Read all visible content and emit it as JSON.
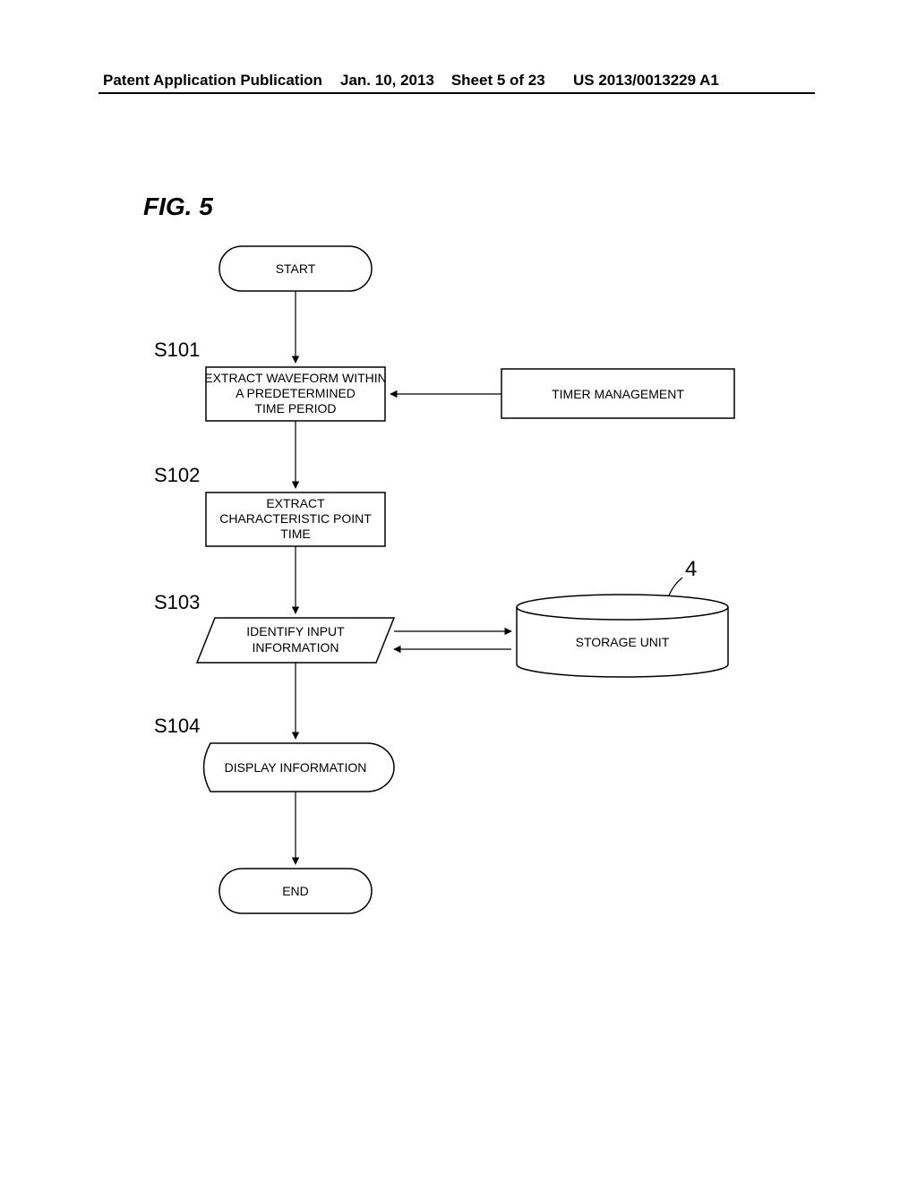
{
  "header": {
    "left": "Patent Application Publication",
    "date": "Jan. 10, 2013",
    "sheet": "Sheet 5 of 23",
    "pubno": "US 2013/0013229 A1"
  },
  "figure_label": "FIG. 5",
  "steps": {
    "s101": "S101",
    "s102": "S102",
    "s103": "S103",
    "s104": "S104"
  },
  "nodes": {
    "start": "START",
    "s101a": "EXTRACT WAVEFORM WITHIN",
    "s101b": "A PREDETERMINED",
    "s101c": "TIME PERIOD",
    "timer": "TIMER MANAGEMENT",
    "s102a": "EXTRACT",
    "s102b": "CHARACTERISTIC POINT",
    "s102c": "TIME",
    "s103a": "IDENTIFY INPUT",
    "s103b": "INFORMATION",
    "storage": "STORAGE UNIT",
    "storage_ref": "4",
    "s104": "DISPLAY INFORMATION",
    "end": "END"
  },
  "chart_data": {
    "type": "flowchart",
    "nodes": [
      {
        "id": "start",
        "shape": "terminator",
        "label": "START"
      },
      {
        "id": "S101",
        "shape": "process",
        "label": "EXTRACT WAVEFORM WITHIN A PREDETERMINED TIME PERIOD"
      },
      {
        "id": "timer",
        "shape": "process",
        "label": "TIMER MANAGEMENT"
      },
      {
        "id": "S102",
        "shape": "process",
        "label": "EXTRACT CHARACTERISTIC POINT TIME"
      },
      {
        "id": "S103",
        "shape": "data",
        "label": "IDENTIFY INPUT INFORMATION"
      },
      {
        "id": "storage",
        "shape": "cylinder",
        "label": "STORAGE UNIT",
        "ref": "4"
      },
      {
        "id": "S104",
        "shape": "display",
        "label": "DISPLAY INFORMATION"
      },
      {
        "id": "end",
        "shape": "terminator",
        "label": "END"
      }
    ],
    "edges": [
      {
        "from": "start",
        "to": "S101"
      },
      {
        "from": "timer",
        "to": "S101"
      },
      {
        "from": "S101",
        "to": "S102"
      },
      {
        "from": "S102",
        "to": "S103"
      },
      {
        "from": "S103",
        "to": "storage",
        "bidirectional": true
      },
      {
        "from": "S103",
        "to": "S104"
      },
      {
        "from": "S104",
        "to": "end"
      }
    ]
  }
}
